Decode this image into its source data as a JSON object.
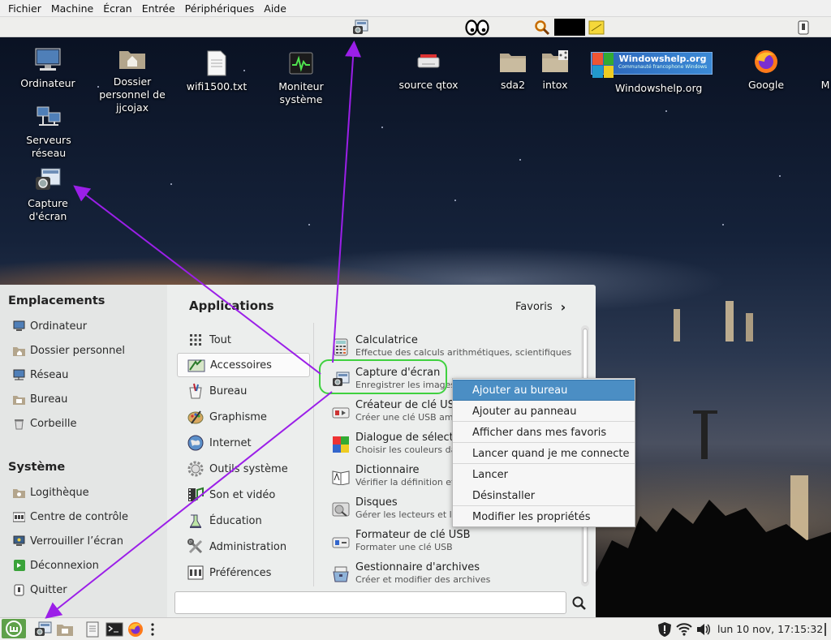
{
  "vm_menubar": [
    "Fichier",
    "Machine",
    "Écran",
    "Entrée",
    "Périphériques",
    "Aide"
  ],
  "desktop_icons": [
    {
      "label": "Ordinateur",
      "icon": "computer-icon"
    },
    {
      "label": "Dossier personnel de jjcojax",
      "icon": "home-folder-icon"
    },
    {
      "label": "wifi1500.txt",
      "icon": "text-file-icon"
    },
    {
      "label": "Moniteur système",
      "icon": "system-monitor-icon"
    },
    {
      "label": "source qtox",
      "icon": "usb-drive-icon"
    },
    {
      "label": "sda2",
      "icon": "folder-icon"
    },
    {
      "label": "intox",
      "icon": "shared-folder-icon"
    },
    {
      "label": "Windowshelp.org",
      "icon": "windowshelp-logo-icon",
      "logo_text": "Windowshelp.org",
      "logo_sub": "Communauté francophone Windows"
    },
    {
      "label": "Google",
      "icon": "firefox-icon"
    },
    {
      "label": "M",
      "icon": "partial-icon"
    },
    {
      "label": "Serveurs réseau",
      "icon": "network-servers-icon"
    },
    {
      "label": "Capture d'écran",
      "icon": "screenshot-icon"
    }
  ],
  "menu": {
    "places_title": "Emplacements",
    "places": [
      "Ordinateur",
      "Dossier personnel",
      "Réseau",
      "Bureau",
      "Corbeille"
    ],
    "system_title": "Système",
    "system": [
      "Logithèque",
      "Centre de contrôle",
      "Verrouiller l’écran",
      "Déconnexion",
      "Quitter"
    ],
    "apps_title": "Applications",
    "favorites_label": "Favoris",
    "categories": [
      "Tout",
      "Accessoires",
      "Bureau",
      "Graphisme",
      "Internet",
      "Outils système",
      "Son et vidéo",
      "Éducation",
      "Administration",
      "Préférences"
    ],
    "selected_category": "Accessoires",
    "apps": [
      {
        "name": "Calculatrice",
        "desc": "Effectue des calculs arithmétiques, scientifiques o..."
      },
      {
        "name": "Capture d'écran",
        "desc": "Enregistrer les images d"
      },
      {
        "name": "Créateur de clé USB",
        "desc": "Créer une clé USB amor"
      },
      {
        "name": "Dialogue de sélectio",
        "desc": "Choisir les couleurs dan"
      },
      {
        "name": "Dictionnaire",
        "desc": "Vérifier la définition et l"
      },
      {
        "name": "Disques",
        "desc": "Gérer les lecteurs et les"
      },
      {
        "name": "Formateur de clé USB",
        "desc": "Formater une clé USB"
      },
      {
        "name": "Gestionnaire d'archives",
        "desc": "Créer et modifier des archives"
      }
    ],
    "search_value": ""
  },
  "context_menu": {
    "items": [
      "Ajouter au bureau",
      "Ajouter au panneau",
      "Afficher dans mes favoris",
      "Lancer quand je me connecte",
      "Lancer",
      "Désinstaller",
      "Modifier les propriétés"
    ],
    "active": "Ajouter au bureau"
  },
  "bottom_panel": {
    "clock": "lun 10 nov, 17:15:32"
  },
  "colors": {
    "annotation_arrow": "#9b1fe8",
    "highlight_ring": "#3fd13f",
    "context_active": "#4b8ec4",
    "panel_bg": "#eeeeec",
    "mint_green": "#6ab04c"
  }
}
